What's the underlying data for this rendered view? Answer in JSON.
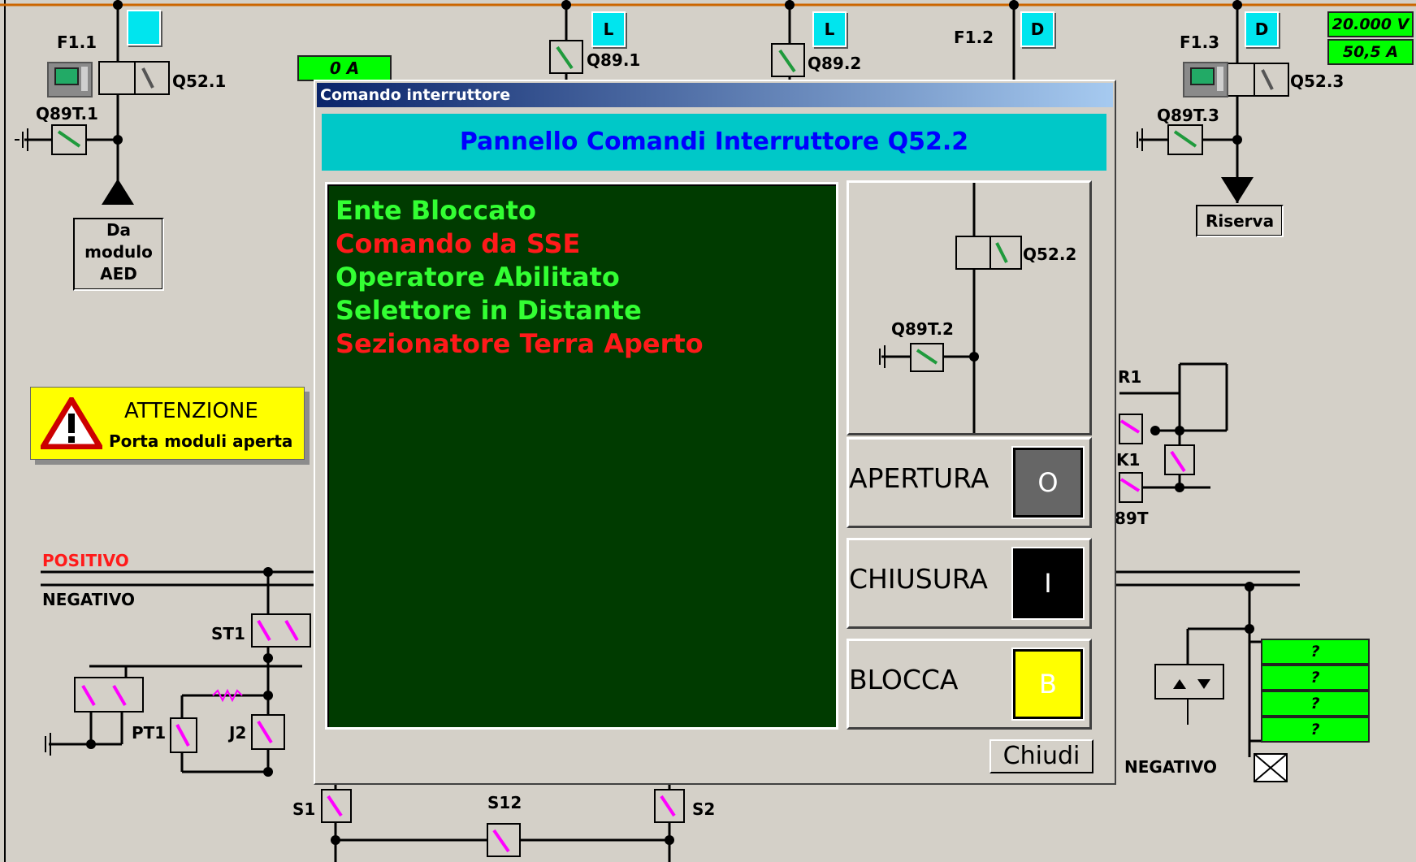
{
  "top_feeders": {
    "f11": {
      "label": "F1.1",
      "breaker": "Q52.1",
      "earth": "Q89T.1",
      "from_lines": [
        "Da",
        "modulo",
        "AED"
      ]
    },
    "q891": {
      "label": "Q89.1",
      "indicator": "L"
    },
    "q892": {
      "label": "Q89.2",
      "indicator": "L"
    },
    "f12": {
      "label": "F1.2",
      "indicator": "D"
    },
    "f13": {
      "label": "F1.3",
      "breaker": "Q52.3",
      "earth": "Q89T.3",
      "indicator": "D",
      "reserve": "Riserva"
    },
    "current_display": "0 A",
    "voltage_display": "20.000 V",
    "amp_display": "50,5 A"
  },
  "warning": {
    "title": "ATTENZIONE",
    "text": "Porta moduli aperta"
  },
  "bus": {
    "positive": "POSITIVO",
    "negative": "NEGATIVO",
    "negative_right": "NEGATIVO"
  },
  "aux_labels": {
    "st1": "ST1",
    "pt1": "PT1",
    "j2": "J2",
    "s1": "S1",
    "s12": "S12",
    "s2": "S2",
    "r1": "R1",
    "k1": "K1",
    "q89t": "89T"
  },
  "unknown_values": [
    "?",
    "?",
    "?",
    "?"
  ],
  "dialog": {
    "title": "Comando interruttore",
    "header": "Pannello Comandi Interruttore Q52.2",
    "status_lines": [
      {
        "text": "Ente Bloccato",
        "color": "#33ff33"
      },
      {
        "text": "Comando da SSE",
        "color": "#ff1a1a"
      },
      {
        "text": "Operatore Abilitato",
        "color": "#33ff33"
      },
      {
        "text": "Selettore in Distante",
        "color": "#33ff33"
      },
      {
        "text": "Sezionatore Terra Aperto",
        "color": "#ff1a1a"
      }
    ],
    "mini_schematic": {
      "breaker": "Q52.2",
      "earth": "Q89T.2"
    },
    "commands": [
      {
        "label": "APERTURA",
        "button": "O",
        "color": "#666666"
      },
      {
        "label": "CHIUSURA",
        "button": "I",
        "color": "#000000"
      },
      {
        "label": "BLOCCA",
        "button": "B",
        "color": "#ffff00"
      }
    ],
    "close_label": "Chiudi"
  }
}
